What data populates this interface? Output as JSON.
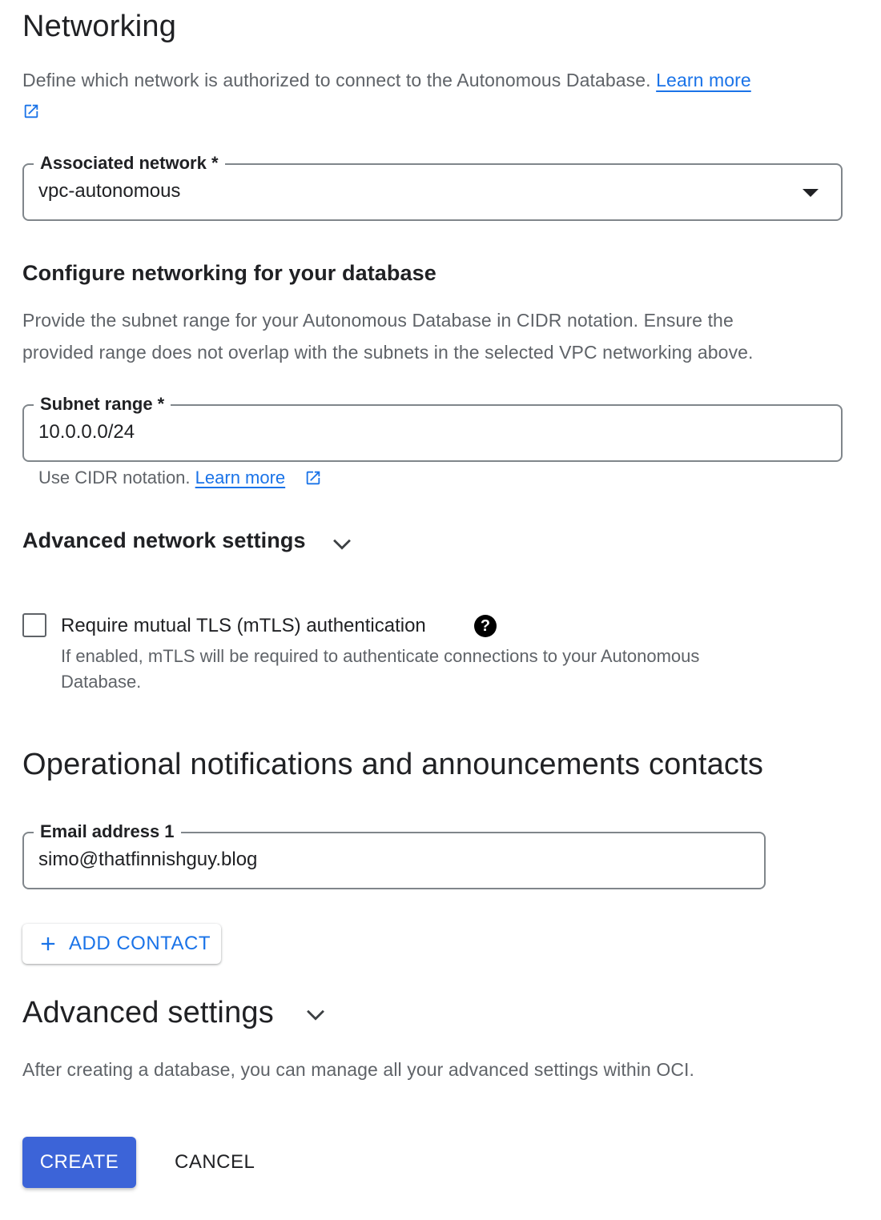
{
  "networking": {
    "title": "Networking",
    "description": "Define which network is authorized to connect to the Autonomous Database.",
    "learn_more": "Learn more",
    "external_link_icon": "open-in-new-icon"
  },
  "associated_network": {
    "label": "Associated network *",
    "value": "vpc-autonomous",
    "dropdown_icon": "arrow-drop-down-icon"
  },
  "configure": {
    "title": "Configure networking for your database",
    "description_line1": "Provide the subnet range for your Autonomous Database in CIDR notation. Ensure the",
    "description_line2": "provided range does not overlap with the subnets in the selected VPC networking above."
  },
  "subnet": {
    "label": "Subnet range *",
    "value": "10.0.0.0/24",
    "hint": "Use CIDR notation.",
    "hint_link": "Learn more"
  },
  "advanced_network": {
    "title": "Advanced network settings",
    "expand_icon": "chevron-down-icon"
  },
  "mtls": {
    "label": "Require mutual TLS (mTLS) authentication",
    "checked": false,
    "help_icon": "help-circle-icon",
    "help_glyph": "?",
    "description_line1": "If enabled, mTLS will be required to authenticate connections to your Autonomous",
    "description_line2": "Database."
  },
  "contacts": {
    "title": "Operational notifications and announcements contacts",
    "email_label": "Email address 1",
    "email_value": "simo@thatfinnishguy.blog",
    "add_contact_label": "ADD CONTACT",
    "add_icon": "plus-icon"
  },
  "advanced_settings": {
    "title": "Advanced settings",
    "expand_icon": "chevron-down-icon",
    "description": "After creating a database, you can manage all your advanced settings within OCI."
  },
  "actions": {
    "create_label": "CREATE",
    "cancel_label": "CANCEL",
    "primary_color": "#3c64d8",
    "link_color": "#1a73e8"
  }
}
